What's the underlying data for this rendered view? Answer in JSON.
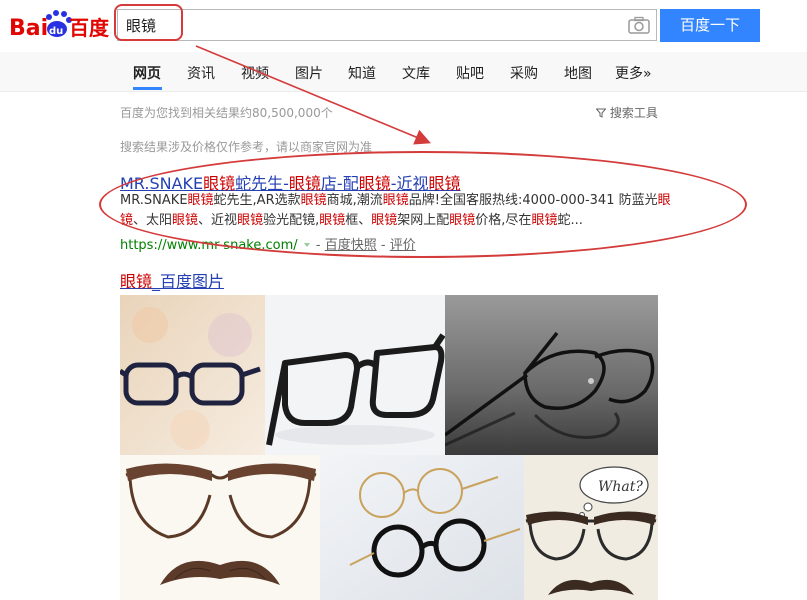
{
  "header": {
    "logo_text_bai": "Bai",
    "logo_text_du": "du",
    "logo_text_cn": "百度",
    "search_value": "眼镜",
    "search_button_label": "百度一下"
  },
  "tabs": [
    {
      "label": "网页"
    },
    {
      "label": "资讯"
    },
    {
      "label": "视频"
    },
    {
      "label": "图片"
    },
    {
      "label": "知道"
    },
    {
      "label": "文库"
    },
    {
      "label": "贴吧"
    },
    {
      "label": "采购"
    },
    {
      "label": "地图"
    },
    {
      "label": "更多»"
    }
  ],
  "stats": {
    "result_count": "百度为您找到相关结果约80,500,000个",
    "tools_label": "搜索工具",
    "price_notice": "搜索结果涉及价格仅作参考，请以商家官网为准"
  },
  "result": {
    "title_parts": [
      "MR.SNAKE",
      "眼镜",
      "蛇先生-",
      "眼镜",
      "店-配",
      "眼镜",
      "-近视",
      "眼镜"
    ],
    "snippet_line1_parts": [
      "MR.SNAKE",
      "眼镜",
      "蛇先生,AR选款",
      "眼镜",
      "商城,潮流",
      "眼镜",
      "品牌!全国客服热线:4000-000-341 防蓝光",
      "眼"
    ],
    "snippet_line2_parts": [
      "镜",
      "、太阳",
      "眼镜",
      "、近视",
      "眼镜",
      "验光配镜,",
      "眼镜",
      "框、",
      "眼镜",
      "架网上配",
      "眼镜",
      "价格,尽在",
      "眼镜",
      "蛇..."
    ],
    "url": "https://www.mr-snake.com/",
    "cache_label": "百度快照",
    "review_label": "评价",
    "separator": "-"
  },
  "images": {
    "title_hl": "眼镜",
    "title_rest": "_百度图片",
    "thought_text": "What?"
  },
  "colors": {
    "brand_blue": "#3385ff",
    "link_blue": "#2440b3",
    "highlight_red": "#cc0000",
    "annotation_red": "#d43b3b",
    "url_green": "#008000"
  }
}
